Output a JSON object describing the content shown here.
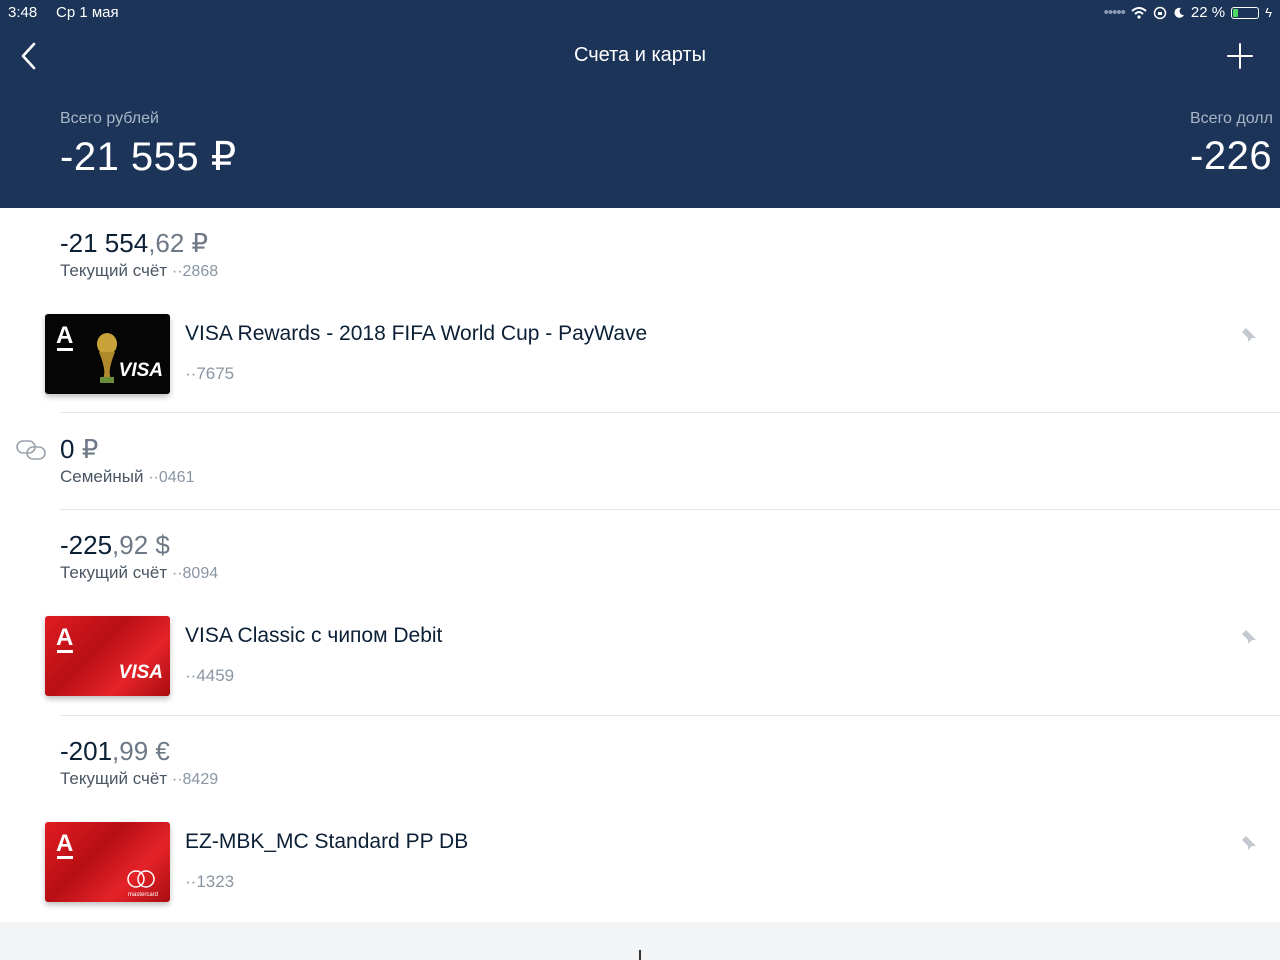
{
  "status_bar": {
    "time": "3:48",
    "date": "Ср 1 мая",
    "battery": "22 %",
    "battery_level": 0.22
  },
  "header": {
    "title": "Счета и карты",
    "back_icon": "chevron-left-icon",
    "add_icon": "plus-icon"
  },
  "totals": [
    {
      "label": "Всего рублей",
      "value": "-21 555 ₽"
    },
    {
      "label": "Всего долл",
      "value": "-226"
    }
  ],
  "accounts": [
    {
      "amount_int": "-21 554",
      "amount_frac": ",62 ₽",
      "type": "Текущий счёт",
      "number": "··2868",
      "card": {
        "name": "VISA Rewards - 2018 FIFA World Cup - PayWave",
        "number": "··7675",
        "brand": "VISA",
        "style": "black",
        "color": "#000000"
      }
    },
    {
      "amount_int": "0",
      "amount_frac": " ₽",
      "type": "Семейный",
      "number": "··0461",
      "linked_icon": "link-icon"
    },
    {
      "amount_int": "-225",
      "amount_frac": ",92 $",
      "type": "Текущий счёт",
      "number": "··8094",
      "card": {
        "name": "VISA Classic с чипом Debit",
        "number": "··4459",
        "brand": "VISA",
        "style": "red",
        "color": "#d7161e"
      }
    },
    {
      "amount_int": "-201",
      "amount_frac": ",99 €",
      "type": "Текущий счёт",
      "number": "··8429",
      "card": {
        "name": "EZ-MBK_MC Standard PP DB",
        "number": "··1323",
        "brand": "mastercard",
        "style": "red",
        "color": "#d7161e"
      }
    }
  ],
  "colors": {
    "header_bg": "#1b3458",
    "accent_red": "#d7161e",
    "text_dark": "#0b1f35",
    "text_muted": "#8a96a3"
  }
}
